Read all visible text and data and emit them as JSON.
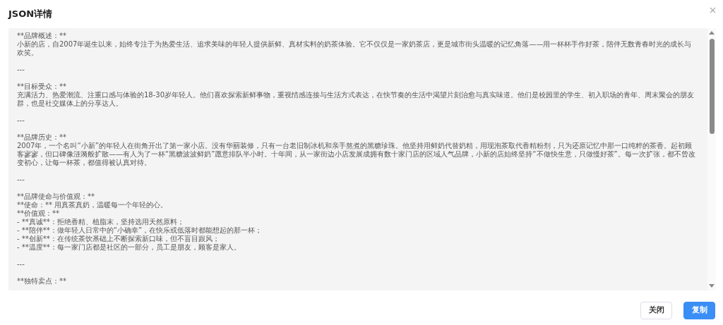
{
  "dialog": {
    "title": "JSON详情",
    "content_sections": [
      [
        "**品牌概述：**",
        "小新的店，自2007年诞生以来，始终专注于为热爱生活、追求美味的年轻人提供新鲜、真材实料的奶茶体验。它不仅仅是一家奶茶店，更是城市街头温暖的记忆角落——用一杯杯手作好茶，陪伴无数青春时光的成长与欢笑。"
      ],
      [
        "---"
      ],
      [
        "**目标受众：**",
        "充满活力、热爱潮流、注重口感与体验的18-30岁年轻人。他们喜欢探索新鲜事物，重视情感连接与生活方式表达，在快节奏的生活中渴望片刻治愈与真实味道。他们是校园里的学生、初入职场的青年、周末聚会的朋友群，也是社交媒体上的分享达人。"
      ],
      [
        "---"
      ],
      [
        "**品牌历史：**",
        "2007年，一个名叫“小新”的年轻人在街角开出了第一家小店。没有华丽装修，只有一台老旧制冰机和亲手熬煮的黑糖珍珠。他坚持用鲜奶代替奶精，用现泡茶取代香精粉剂，只为还原记忆中那一口纯粹的茶香。起初顾客寥寥，但口碑像涟漪般扩散——有人为了一杯“黑糖波波鲜奶”愿意排队半小时。十年间，从一家街边小店发展成拥有数十家门店的区域人气品牌，小新的店始终坚持“不做快生意，只做慢好茶”。每一次扩张，都不曾改变初心，让每一杯茶，都值得被认真对待。"
      ],
      [
        "---"
      ],
      [
        "**品牌使命与价值观：**",
        "**使命：** 用真茶真奶，温暖每一个年轻的心。",
        "**价值观：**",
        "- **真诚**：拒绝香精、植脂末，坚持选用天然原料；",
        "- **陪伴**：做年轻人日常中的“小确幸”，在快乐或低落时都能想起的那一杯；",
        "- **创新**：在传统茶饮基础上不断探索新口味，但不盲目跟风；",
        "- **温度**：每一家门店都是社区的一部分，员工是朋友，顾客是家人。"
      ],
      [
        "---"
      ],
      [
        "**独特卖点：**"
      ]
    ],
    "buttons": [
      {
        "label": "关闭",
        "kind": "secondary"
      },
      {
        "label": "复制",
        "kind": "primary"
      }
    ]
  }
}
